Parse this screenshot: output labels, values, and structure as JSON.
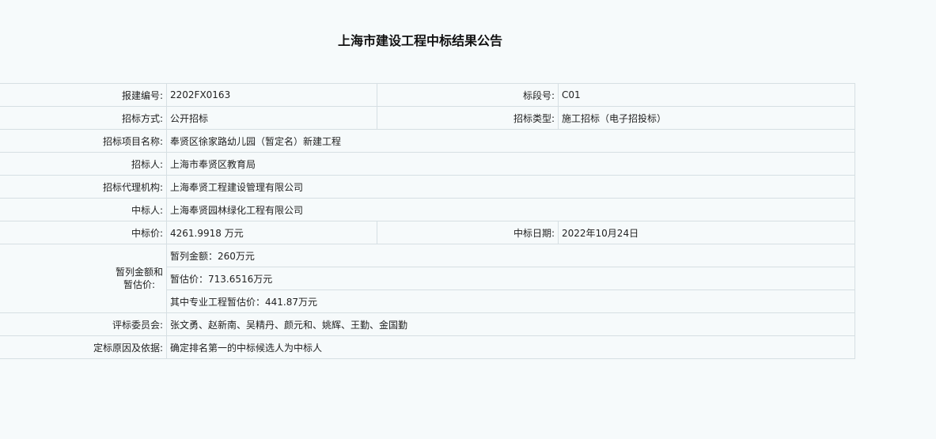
{
  "title": "上海市建设工程中标结果公告",
  "rows": {
    "baojian_label": "报建编号:",
    "baojian_value": "2202FX0163",
    "biaoduan_label": "标段号:",
    "biaoduan_value": "C01",
    "fangshi_label": "招标方式:",
    "fangshi_value": "公开招标",
    "leixing_label": "招标类型:",
    "leixing_value": "施工招标（电子招投标）",
    "xiangmu_label": "招标项目名称:",
    "xiangmu_value": "奉贤区徐家路幼儿园（暂定名）新建工程",
    "zhaobiaoren_label": "招标人:",
    "zhaobiaoren_value": "上海市奉贤区教育局",
    "daili_label": "招标代理机构:",
    "daili_value": "上海奉贤工程建设管理有限公司",
    "zhongbiaoren_label": "中标人:",
    "zhongbiaoren_value": "上海奉贤园林绿化工程有限公司",
    "jia_label": "中标价:",
    "jia_value": "4261.9918 万元",
    "riqi_label": "中标日期:",
    "riqi_value": "2022年10月24日",
    "zanlie_label_line1": "暂列金额和",
    "zanlie_label_line2": "暂估价:",
    "zanlie_value": "暂列金额：260万元",
    "zangu_value": "暂估价：713.6516万元",
    "zhuanye_value": "其中专业工程暂估价：441.87万元",
    "weiyuan_label": "评标委员会:",
    "weiyuan_value": "张文勇、赵新南、吴精丹、颜元和、姚辉、王勤、金国勤",
    "yuanyin_label": "定标原因及依据:",
    "yuanyin_value": "确定排名第一的中标候选人为中标人"
  }
}
